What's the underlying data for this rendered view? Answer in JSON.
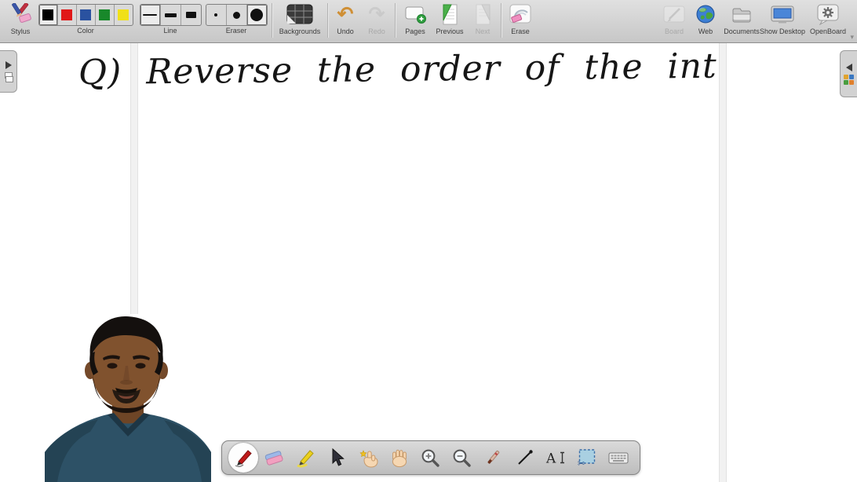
{
  "app": {
    "title": "OpenBoard"
  },
  "top_toolbar": {
    "stylus": {
      "label": "Stylus"
    },
    "color": {
      "label": "Color",
      "swatches": [
        "#000000",
        "#e01818",
        "#2a52a0",
        "#18882a",
        "#f0e018"
      ],
      "selected_index": 0
    },
    "line": {
      "label": "Line",
      "options": [
        "thin",
        "medium",
        "thick"
      ],
      "selected_index": 0
    },
    "eraser": {
      "label": "Eraser",
      "options": [
        "small",
        "medium",
        "large"
      ],
      "selected_index": 2
    },
    "backgrounds": {
      "label": "Backgrounds"
    },
    "undo": {
      "label": "Undo",
      "enabled": true,
      "glyph": "↶"
    },
    "redo": {
      "label": "Redo",
      "enabled": false,
      "glyph": "↷"
    },
    "pages": {
      "label": "Pages"
    },
    "previous": {
      "label": "Previous",
      "enabled": true
    },
    "next": {
      "label": "Next",
      "enabled": false
    },
    "erase": {
      "label": "Erase"
    },
    "board": {
      "label": "Board",
      "enabled": false
    },
    "web": {
      "label": "Web"
    },
    "documents": {
      "label": "Documents"
    },
    "show_desktop": {
      "label": "Show Desktop"
    },
    "openboard": {
      "label": "OpenBoard"
    },
    "overflow_caret": "▾"
  },
  "canvas": {
    "handwriting": "Q) Reverse the order of the int",
    "ink_color": "#161616",
    "page_margin_color": "#f1f1f1"
  },
  "side_tabs": {
    "left": {
      "name": "page-navigator-tab"
    },
    "right": {
      "name": "library-tab"
    }
  },
  "webcam": {
    "description": "presenter webcam overlay"
  },
  "bottom_toolbar": {
    "selected_tool": "pen",
    "tools": [
      {
        "name": "pen",
        "icon": "red-pen-icon"
      },
      {
        "name": "eraser",
        "icon": "eraser-icon"
      },
      {
        "name": "highlighter",
        "icon": "yellow-marker-icon"
      },
      {
        "name": "selector",
        "icon": "arrow-cursor-icon"
      },
      {
        "name": "interact",
        "icon": "magic-finger-icon"
      },
      {
        "name": "pan",
        "icon": "open-hand-icon"
      },
      {
        "name": "zoom-in",
        "icon": "magnifier-plus-icon"
      },
      {
        "name": "zoom-out",
        "icon": "magnifier-minus-icon"
      },
      {
        "name": "laser-pointer",
        "icon": "pointer-stick-icon"
      },
      {
        "name": "draw-line",
        "icon": "diagonal-line-icon"
      },
      {
        "name": "write-text",
        "icon": "text-cursor-icon"
      },
      {
        "name": "capture",
        "icon": "capture-area-icon"
      },
      {
        "name": "virtual-keyboard",
        "icon": "keyboard-icon"
      }
    ]
  }
}
